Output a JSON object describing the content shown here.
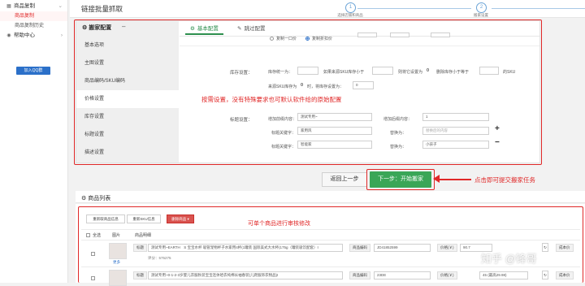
{
  "nav": {
    "group1": "商品复制",
    "item1": "商品复制",
    "item2": "商品复制历史",
    "group2": "帮助中心",
    "qq": "加入QQ群"
  },
  "header": {
    "title": "链接批量抓取",
    "steps": [
      {
        "num": "1",
        "label": "选择店铺和商品"
      },
      {
        "num": "2",
        "label": "搬家设置"
      }
    ]
  },
  "config": {
    "title": "搬家配置",
    "minus": "–",
    "tabs": [
      "基本配置",
      "跳过配置"
    ],
    "sidebar": [
      "基本选项",
      "主图设置",
      "商品编码/SKU编码",
      "价格设置",
      "库存设置",
      "标题设置",
      "描述设置"
    ],
    "radio1": "复制一口价",
    "radio2": "复制折扣价",
    "stock_label": "库存设置：",
    "stock_text1": "库存统一为：",
    "stock_text2": "如果来源SKU库存小于",
    "stock_text3": "则将它设置为",
    "stock_zero": "0",
    "stock_text4": "删除库存小于等于",
    "stock_text5": "的SKU",
    "stock_line2a": "来源SKU库存为",
    "stock_line2b": "0",
    "stock_line2c": "时，将库存设置为：",
    "stock_line2_value": "0",
    "title_label": "标题设置：",
    "prefix_label": "增加前缀内容：",
    "prefix_value": "测试专用~",
    "suffix_label": "增加后缀内容：",
    "suffix_value": "1",
    "replace_kw1_label": "标题关键字：",
    "replace_kw1_value": "家用风",
    "replace_to1_label": "替换为：",
    "replace_to1_placeholder": "替换后的内容",
    "replace_kw2_label": "标题关键字：",
    "replace_kw2_value": "智能家",
    "replace_to2_label": "替换为：",
    "replace_to2_value": "小孩子",
    "plus": "+",
    "minus2": "−",
    "annotation": "按需设置，没有特殊要求也可默认软件给的原始配置"
  },
  "actions": {
    "prev": "返回上一步",
    "next": "下一步：开始搬家",
    "annotation": "点击即可提交搬家任务"
  },
  "list": {
    "title": "商品列表",
    "btn1": "重新取商品信息",
    "btn2": "重新SKU信息",
    "btn3": "删除商品 ▾",
    "annotation": "可单个商品进行审核修改",
    "col_select": "全选",
    "col_image": "图片",
    "col_info": "商品明细",
    "rows": [
      {
        "tag": "标题",
        "title": "测试专用~EARTH　S 宝宝水杯 吸管宠物杯子水家用4杯(1罐装 国际美式大水杯(175g（罐装吸饮配套）I",
        "sub": "评分：575275",
        "code_label": "商品编码",
        "code": "JD41852599",
        "price_label": "价格(￥)",
        "price": "90.7",
        "cost": "成本价",
        "thumb_caption": "更多"
      },
      {
        "tag": "标题",
        "title": "测试专用~0-1-2-3岁婴儿衣服秋装宝宝连体哈衣纯棉长袖春装(儿爬服饰衣物品)I",
        "sub": "",
        "code_label": "商品编码",
        "code": "23DE",
        "price_label": "价格(￥)",
        "price": "45 (最高29.98)",
        "cost": "成本价"
      }
    ]
  },
  "watermark": "知乎 @锋哥"
}
